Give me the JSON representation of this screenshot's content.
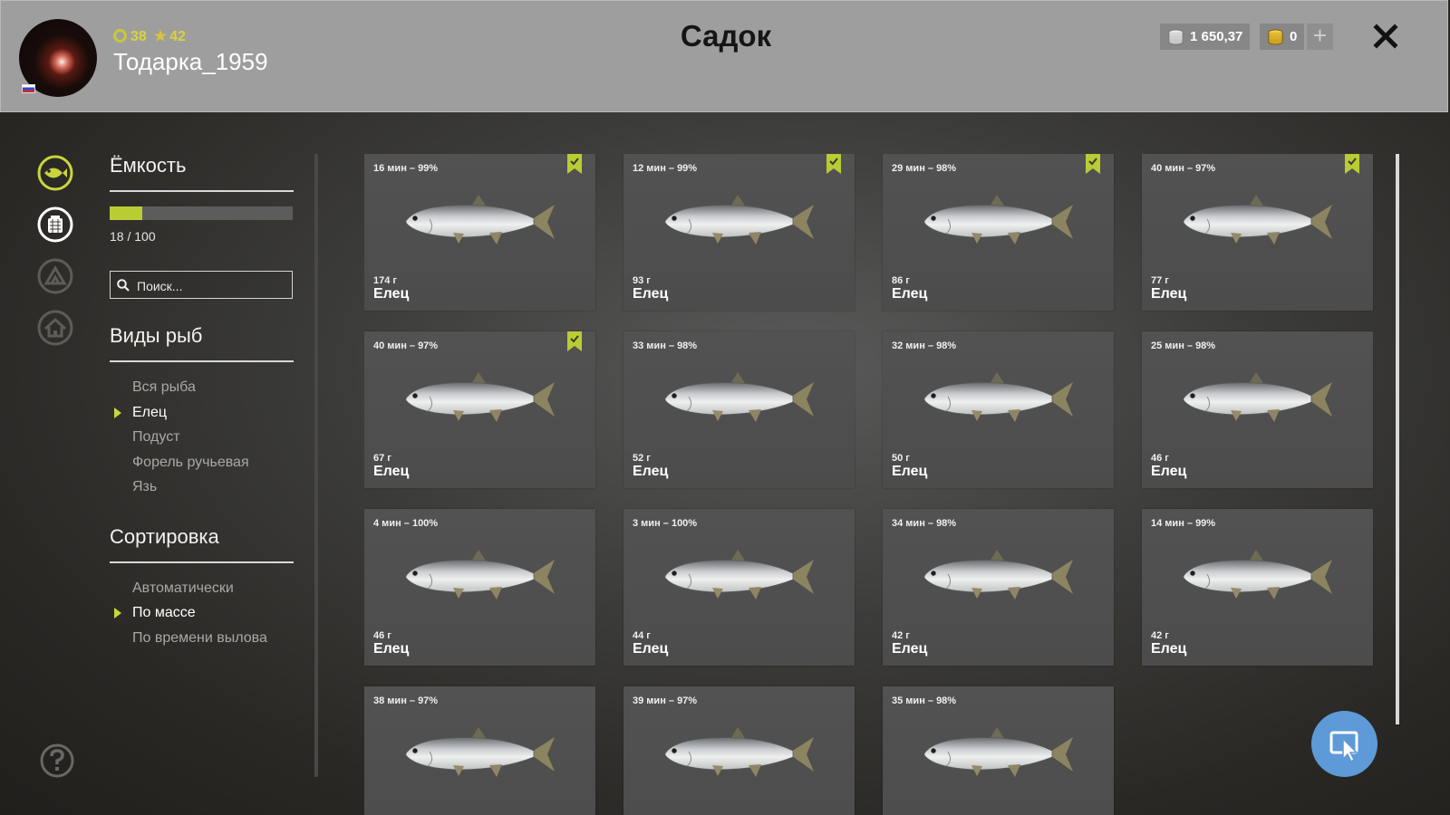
{
  "header": {
    "title": "Садок",
    "username": "Тодарка_1959",
    "level": "38",
    "rating": "42",
    "money": "1 650,37",
    "gold": "0",
    "plus_label": "+",
    "colors": {
      "accent": "#c9d53b",
      "header_bg": "#9e9e9e"
    }
  },
  "rail": {
    "icons": [
      "fish-tab-icon",
      "keepnet-tab-icon",
      "camp-tab-icon",
      "home-tab-icon"
    ],
    "active": "keepnet-tab-icon"
  },
  "capacity": {
    "heading": "Ёмкость",
    "fill_fraction": 0.18,
    "text": "18 / 100"
  },
  "search": {
    "placeholder": "Поиск..."
  },
  "species": {
    "heading": "Виды рыб",
    "items": [
      {
        "label": "Вся рыба",
        "active": false
      },
      {
        "label": "Елец",
        "active": true
      },
      {
        "label": "Подуст",
        "active": false
      },
      {
        "label": "Форель ручьевая",
        "active": false
      },
      {
        "label": "Язь",
        "active": false
      }
    ]
  },
  "sorting": {
    "heading": "Сортировка",
    "items": [
      {
        "label": "Автоматически",
        "active": false
      },
      {
        "label": "По массе",
        "active": true
      },
      {
        "label": "По времени вылова",
        "active": false
      }
    ]
  },
  "fish": [
    {
      "time": "16 мин – 99%",
      "weight": "174 г",
      "species": "Елец",
      "bookmarked": true
    },
    {
      "time": "12 мин – 99%",
      "weight": "93 г",
      "species": "Елец",
      "bookmarked": true
    },
    {
      "time": "29 мин – 98%",
      "weight": "86 г",
      "species": "Елец",
      "bookmarked": true
    },
    {
      "time": "40 мин – 97%",
      "weight": "77 г",
      "species": "Елец",
      "bookmarked": true
    },
    {
      "time": "40 мин – 97%",
      "weight": "67 г",
      "species": "Елец",
      "bookmarked": true
    },
    {
      "time": "33 мин – 98%",
      "weight": "52 г",
      "species": "Елец",
      "bookmarked": false
    },
    {
      "time": "32 мин – 98%",
      "weight": "50 г",
      "species": "Елец",
      "bookmarked": false
    },
    {
      "time": "25 мин – 98%",
      "weight": "46 г",
      "species": "Елец",
      "bookmarked": false
    },
    {
      "time": "4 мин – 100%",
      "weight": "46 г",
      "species": "Елец",
      "bookmarked": false
    },
    {
      "time": "3 мин – 100%",
      "weight": "44 г",
      "species": "Елец",
      "bookmarked": false
    },
    {
      "time": "34 мин – 98%",
      "weight": "42 г",
      "species": "Елец",
      "bookmarked": false
    },
    {
      "time": "14 мин – 99%",
      "weight": "42 г",
      "species": "Елец",
      "bookmarked": false
    },
    {
      "time": "38 мин – 97%",
      "weight": "",
      "species": "",
      "bookmarked": false
    },
    {
      "time": "39 мин – 97%",
      "weight": "",
      "species": "",
      "bookmarked": false
    },
    {
      "time": "35 мин – 98%",
      "weight": "",
      "species": "",
      "bookmarked": false
    }
  ]
}
